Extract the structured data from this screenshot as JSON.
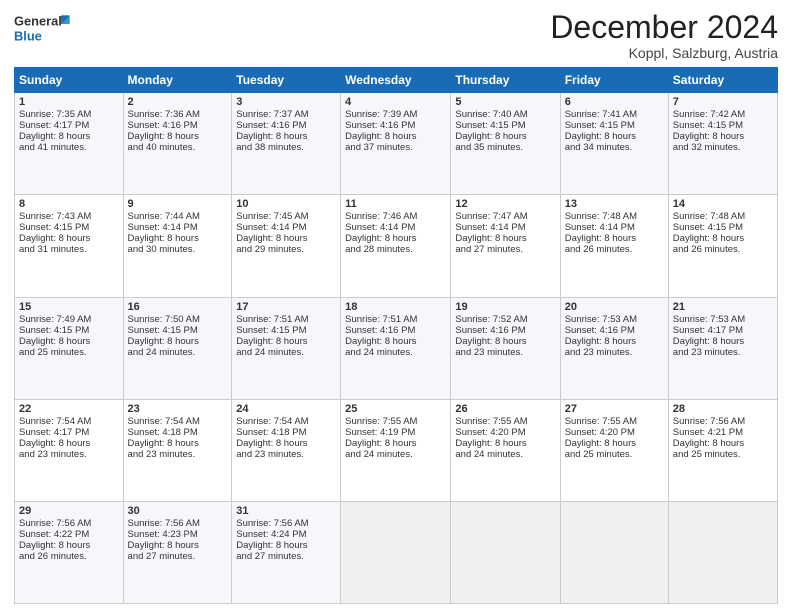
{
  "header": {
    "logo": {
      "line1": "General",
      "line2": "Blue"
    },
    "title": "December 2024",
    "location": "Koppl, Salzburg, Austria"
  },
  "weekdays": [
    "Sunday",
    "Monday",
    "Tuesday",
    "Wednesday",
    "Thursday",
    "Friday",
    "Saturday"
  ],
  "weeks": [
    [
      {
        "day": "1",
        "info": "Sunrise: 7:35 AM\nSunset: 4:17 PM\nDaylight: 8 hours\nand 41 minutes."
      },
      {
        "day": "2",
        "info": "Sunrise: 7:36 AM\nSunset: 4:16 PM\nDaylight: 8 hours\nand 40 minutes."
      },
      {
        "day": "3",
        "info": "Sunrise: 7:37 AM\nSunset: 4:16 PM\nDaylight: 8 hours\nand 38 minutes."
      },
      {
        "day": "4",
        "info": "Sunrise: 7:39 AM\nSunset: 4:16 PM\nDaylight: 8 hours\nand 37 minutes."
      },
      {
        "day": "5",
        "info": "Sunrise: 7:40 AM\nSunset: 4:15 PM\nDaylight: 8 hours\nand 35 minutes."
      },
      {
        "day": "6",
        "info": "Sunrise: 7:41 AM\nSunset: 4:15 PM\nDaylight: 8 hours\nand 34 minutes."
      },
      {
        "day": "7",
        "info": "Sunrise: 7:42 AM\nSunset: 4:15 PM\nDaylight: 8 hours\nand 32 minutes."
      }
    ],
    [
      {
        "day": "8",
        "info": "Sunrise: 7:43 AM\nSunset: 4:15 PM\nDaylight: 8 hours\nand 31 minutes."
      },
      {
        "day": "9",
        "info": "Sunrise: 7:44 AM\nSunset: 4:14 PM\nDaylight: 8 hours\nand 30 minutes."
      },
      {
        "day": "10",
        "info": "Sunrise: 7:45 AM\nSunset: 4:14 PM\nDaylight: 8 hours\nand 29 minutes."
      },
      {
        "day": "11",
        "info": "Sunrise: 7:46 AM\nSunset: 4:14 PM\nDaylight: 8 hours\nand 28 minutes."
      },
      {
        "day": "12",
        "info": "Sunrise: 7:47 AM\nSunset: 4:14 PM\nDaylight: 8 hours\nand 27 minutes."
      },
      {
        "day": "13",
        "info": "Sunrise: 7:48 AM\nSunset: 4:14 PM\nDaylight: 8 hours\nand 26 minutes."
      },
      {
        "day": "14",
        "info": "Sunrise: 7:48 AM\nSunset: 4:15 PM\nDaylight: 8 hours\nand 26 minutes."
      }
    ],
    [
      {
        "day": "15",
        "info": "Sunrise: 7:49 AM\nSunset: 4:15 PM\nDaylight: 8 hours\nand 25 minutes."
      },
      {
        "day": "16",
        "info": "Sunrise: 7:50 AM\nSunset: 4:15 PM\nDaylight: 8 hours\nand 24 minutes."
      },
      {
        "day": "17",
        "info": "Sunrise: 7:51 AM\nSunset: 4:15 PM\nDaylight: 8 hours\nand 24 minutes."
      },
      {
        "day": "18",
        "info": "Sunrise: 7:51 AM\nSunset: 4:16 PM\nDaylight: 8 hours\nand 24 minutes."
      },
      {
        "day": "19",
        "info": "Sunrise: 7:52 AM\nSunset: 4:16 PM\nDaylight: 8 hours\nand 23 minutes."
      },
      {
        "day": "20",
        "info": "Sunrise: 7:53 AM\nSunset: 4:16 PM\nDaylight: 8 hours\nand 23 minutes."
      },
      {
        "day": "21",
        "info": "Sunrise: 7:53 AM\nSunset: 4:17 PM\nDaylight: 8 hours\nand 23 minutes."
      }
    ],
    [
      {
        "day": "22",
        "info": "Sunrise: 7:54 AM\nSunset: 4:17 PM\nDaylight: 8 hours\nand 23 minutes."
      },
      {
        "day": "23",
        "info": "Sunrise: 7:54 AM\nSunset: 4:18 PM\nDaylight: 8 hours\nand 23 minutes."
      },
      {
        "day": "24",
        "info": "Sunrise: 7:54 AM\nSunset: 4:18 PM\nDaylight: 8 hours\nand 23 minutes."
      },
      {
        "day": "25",
        "info": "Sunrise: 7:55 AM\nSunset: 4:19 PM\nDaylight: 8 hours\nand 24 minutes."
      },
      {
        "day": "26",
        "info": "Sunrise: 7:55 AM\nSunset: 4:20 PM\nDaylight: 8 hours\nand 24 minutes."
      },
      {
        "day": "27",
        "info": "Sunrise: 7:55 AM\nSunset: 4:20 PM\nDaylight: 8 hours\nand 25 minutes."
      },
      {
        "day": "28",
        "info": "Sunrise: 7:56 AM\nSunset: 4:21 PM\nDaylight: 8 hours\nand 25 minutes."
      }
    ],
    [
      {
        "day": "29",
        "info": "Sunrise: 7:56 AM\nSunset: 4:22 PM\nDaylight: 8 hours\nand 26 minutes."
      },
      {
        "day": "30",
        "info": "Sunrise: 7:56 AM\nSunset: 4:23 PM\nDaylight: 8 hours\nand 27 minutes."
      },
      {
        "day": "31",
        "info": "Sunrise: 7:56 AM\nSunset: 4:24 PM\nDaylight: 8 hours\nand 27 minutes."
      },
      null,
      null,
      null,
      null
    ]
  ]
}
